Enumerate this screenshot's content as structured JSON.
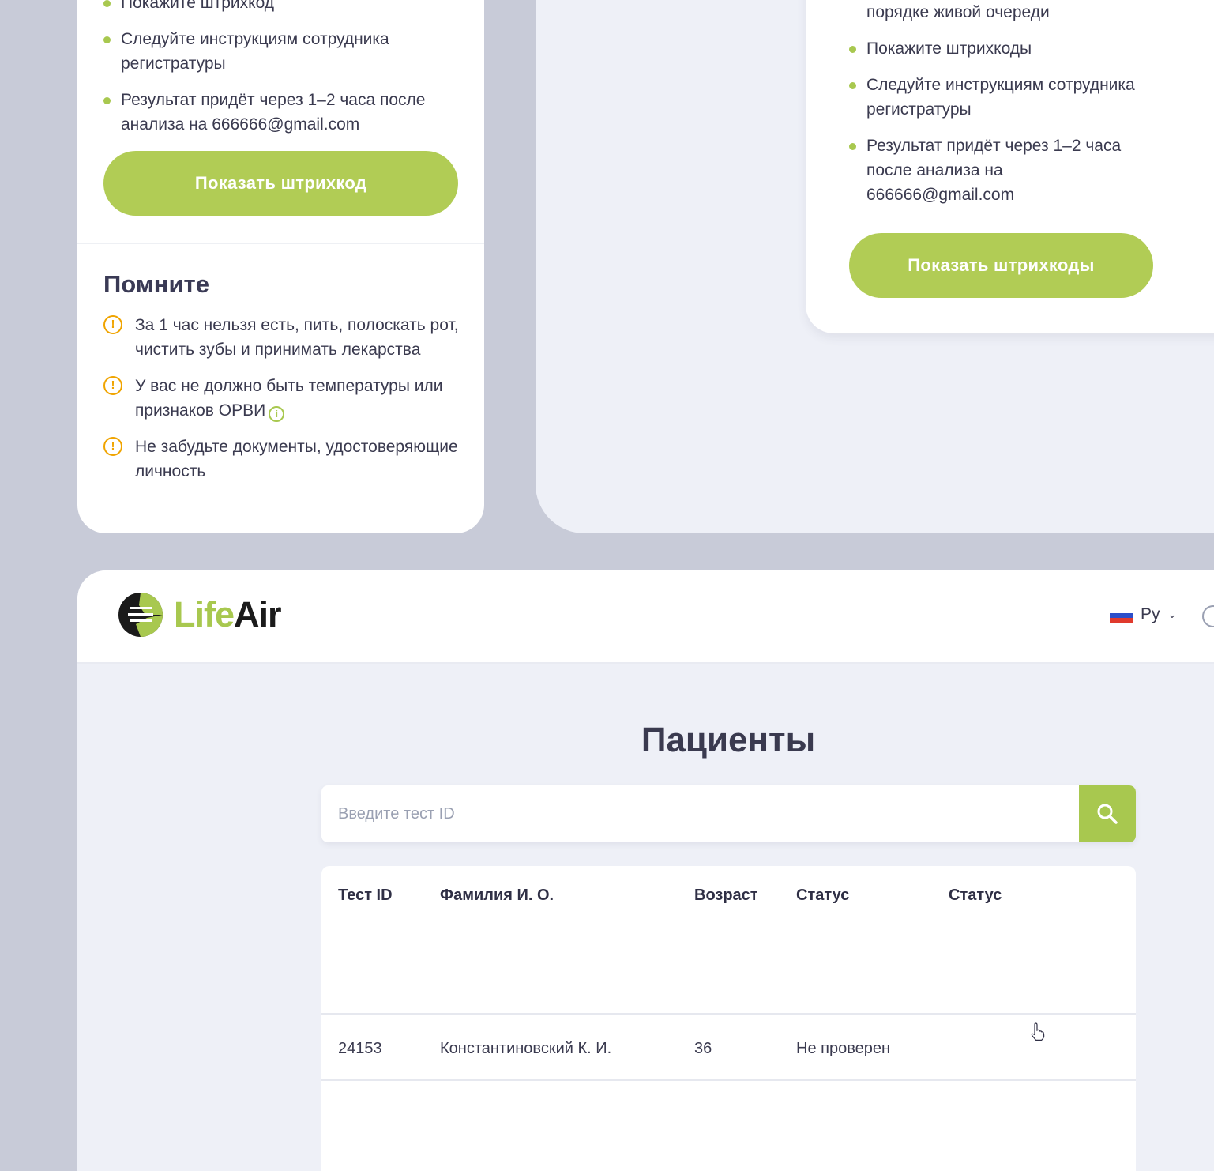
{
  "left_card": {
    "bullets": [
      "Покажите штрихкод",
      "Следуйте инструкциям сотрудника регистратуры",
      "Результат придёт через 1–2 часа после анализа на 666666@gmail.com"
    ],
    "button_label": "Показать штрихкод",
    "remember": {
      "title": "Помните",
      "items": [
        "За 1 час нельзя есть, пить, полоскать рот, чистить зубы и принимать лекарства",
        "У вас не должно быть температуры или признаков ОРВИ",
        "Не забудьте документы, удостоверяющие личность"
      ],
      "icon": "warning-icon",
      "info_icon": "info-icon"
    }
  },
  "right_card": {
    "bullets": [
      "порядке живой очереди",
      "Покажите штрихкоды",
      "Следуйте инструкциям сотрудника регистратуры",
      "Результат придёт через 1–2 часа после анализа на 666666@gmail.com"
    ],
    "button_label": "Показать штрихкоды"
  },
  "app": {
    "logo": {
      "part1": "Life",
      "part2": "Air"
    },
    "language": {
      "label": "Ру",
      "flag": "russia-flag"
    },
    "page_title": "Пациенты",
    "search": {
      "placeholder": "Введите тест ID",
      "value": "",
      "icon": "search-icon"
    },
    "table": {
      "columns": [
        "Тест ID",
        "Фамилия И. О.",
        "Возраст",
        "Статус",
        "Статус"
      ],
      "rows": [
        [
          "24153",
          "Константиновский К. И.",
          "36",
          "Не проверен",
          ""
        ]
      ]
    }
  },
  "colors": {
    "accent": "#b1cc55",
    "warning": "#f0a400",
    "background": "#c8cbd8",
    "panel": "#eef0f7",
    "text": "#2f2f45"
  }
}
